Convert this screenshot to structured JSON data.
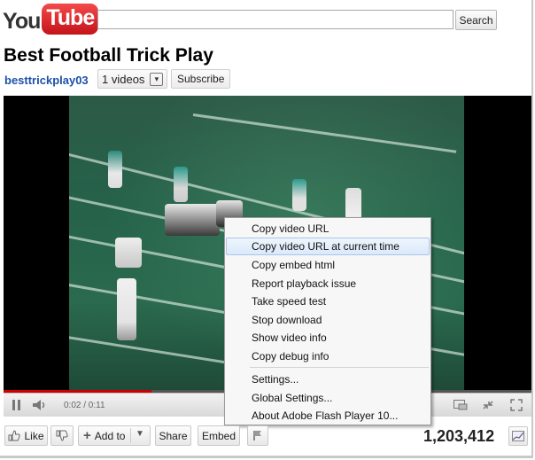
{
  "header": {
    "logo_you": "You",
    "logo_tube": "Tube",
    "search_placeholder": "",
    "search_button": "Search"
  },
  "video": {
    "title": "Best Football Trick Play",
    "channel": "besttrickplay03",
    "videos_button": "1 videos",
    "subscribe_button": "Subscribe",
    "time_display": "0:02 / 0:11",
    "progress": 0.28
  },
  "context_menu": {
    "items": [
      "Copy video URL",
      "Copy video URL at current time",
      "Copy embed html",
      "Report playback issue",
      "Take speed test",
      "Stop download",
      "Show video info",
      "Copy debug info",
      "Settings...",
      "Global Settings...",
      "About Adobe Flash Player 10..."
    ],
    "highlighted": "Copy video URL at current time"
  },
  "actions": {
    "like": "Like",
    "add_to": "Add to",
    "share": "Share",
    "embed": "Embed",
    "views": "1,203,412"
  },
  "colors": {
    "brand_red": "#cc181e",
    "channel_link": "#1c51a8",
    "progress_played": "#cc0000"
  }
}
